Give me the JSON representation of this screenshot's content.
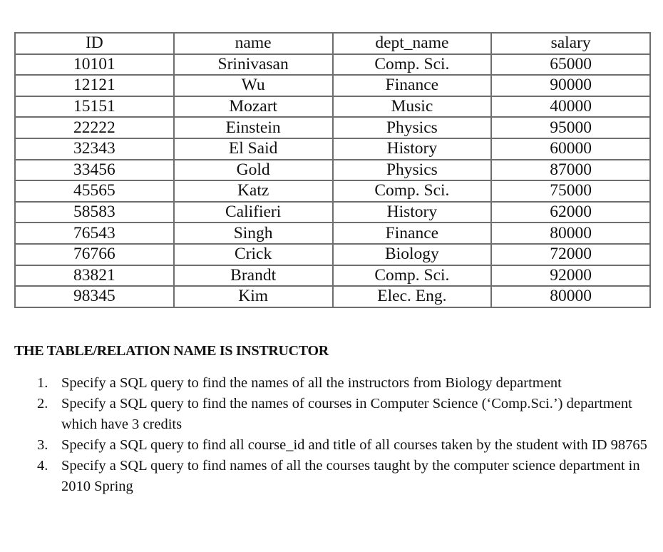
{
  "table": {
    "headers": [
      "ID",
      "name",
      "dept_name",
      "salary"
    ],
    "rows": [
      [
        "10101",
        "Srinivasan",
        "Comp. Sci.",
        "65000"
      ],
      [
        "12121",
        "Wu",
        "Finance",
        "90000"
      ],
      [
        "15151",
        "Mozart",
        "Music",
        "40000"
      ],
      [
        "22222",
        "Einstein",
        "Physics",
        "95000"
      ],
      [
        "32343",
        "El Said",
        "History",
        "60000"
      ],
      [
        "33456",
        "Gold",
        "Physics",
        "87000"
      ],
      [
        "45565",
        "Katz",
        "Comp. Sci.",
        "75000"
      ],
      [
        "58583",
        "Califieri",
        "History",
        "62000"
      ],
      [
        "76543",
        "Singh",
        "Finance",
        "80000"
      ],
      [
        "76766",
        "Crick",
        "Biology",
        "72000"
      ],
      [
        "83821",
        "Brandt",
        "Comp. Sci.",
        "92000"
      ],
      [
        "98345",
        "Kim",
        "Elec. Eng.",
        "80000"
      ]
    ]
  },
  "heading": "THE TABLE/RELATION NAME IS INSTRUCTOR",
  "questions": [
    {
      "num": "1.",
      "text": "Specify a SQL query to find the names of all the instructors from Biology department"
    },
    {
      "num": "2.",
      "text": "Specify a SQL query to find the names of courses in Computer Science (‘Comp.Sci.’) department which have 3 credits"
    },
    {
      "num": "3.",
      "text": "Specify a SQL query to find all course_id and title of all courses taken by the student with ID 98765"
    },
    {
      "num": "4.",
      "text": "Specify a SQL query to find names of all the courses taught by the computer science department in 2010 Spring"
    }
  ]
}
